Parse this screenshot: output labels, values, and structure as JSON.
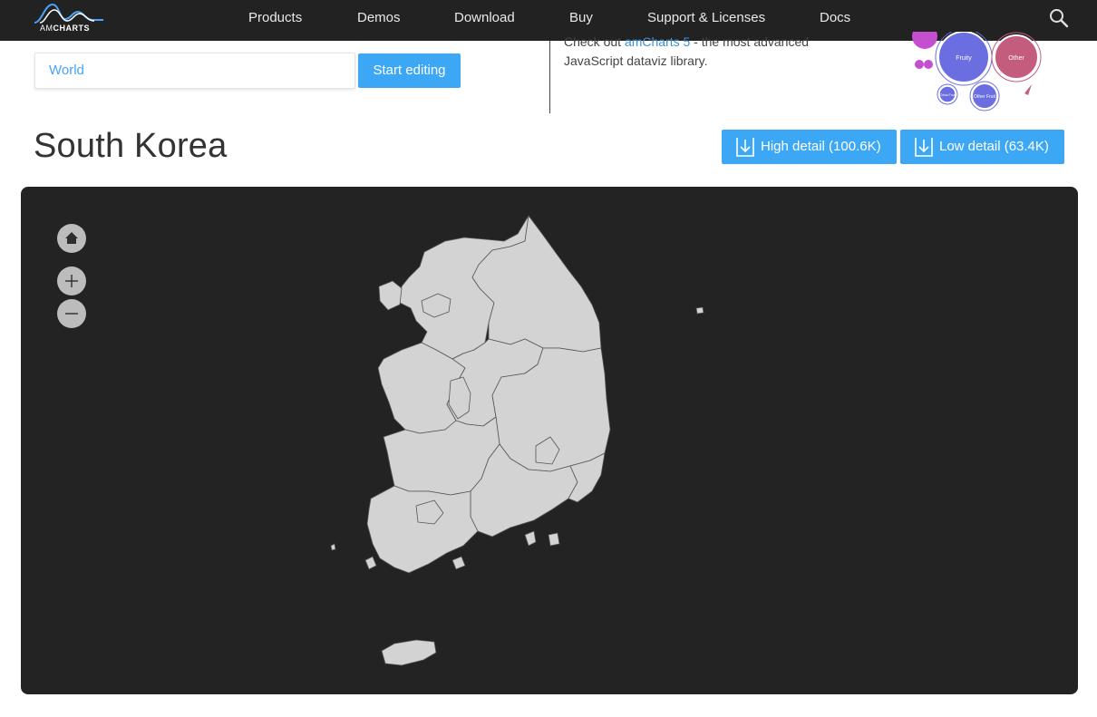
{
  "nav": {
    "logo_text_a": "AM",
    "logo_text_b": "CHARTS",
    "items": [
      "Products",
      "Demos",
      "Download",
      "Buy",
      "Support & Licenses",
      "Docs"
    ],
    "search_icon": "search-icon"
  },
  "search": {
    "value": "World",
    "button_label": "Start editing"
  },
  "promo": {
    "line1_pre": "Check out ",
    "link": "amCharts 5",
    "line1_post": " - the most advanced",
    "line2": "JavaScript dataviz library.",
    "bubbles": [
      "Fruity",
      "Other",
      "Other Fruit",
      "Citrus Fruit"
    ]
  },
  "page": {
    "title": "South Korea"
  },
  "downloads": {
    "high": "High detail (100.6K)",
    "low": "Low detail (63.4K)"
  },
  "map": {
    "background": "#232323",
    "land_color": "#d3d3d3",
    "controls": [
      "home-icon",
      "zoom-in-icon",
      "zoom-out-icon"
    ]
  }
}
